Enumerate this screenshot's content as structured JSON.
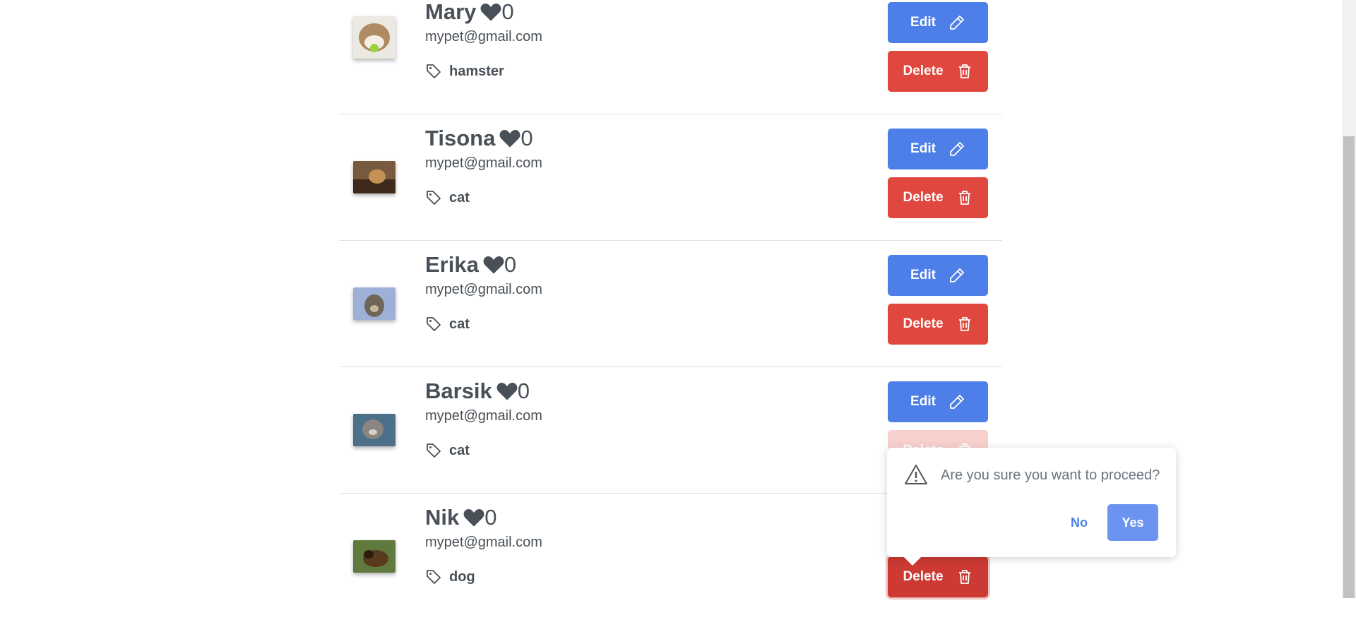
{
  "pets": [
    {
      "name": "Mary",
      "likes": "0",
      "email": "mypet@gmail.com",
      "tag": "hamster",
      "image": "hamster-photo"
    },
    {
      "name": "Tisona",
      "likes": "0",
      "email": "mypet@gmail.com",
      "tag": "cat",
      "image": "cat-photo"
    },
    {
      "name": "Erika",
      "likes": "0",
      "email": "mypet@gmail.com",
      "tag": "cat",
      "image": "cat-photo"
    },
    {
      "name": "Barsik",
      "likes": "0",
      "email": "mypet@gmail.com",
      "tag": "cat",
      "image": "cat-photo"
    },
    {
      "name": "Nik",
      "likes": "0",
      "email": "mypet@gmail.com",
      "tag": "dog",
      "image": "dog-photo"
    }
  ],
  "buttons": {
    "edit": "Edit",
    "delete": "Delete"
  },
  "confirm": {
    "message": "Are you sure you want to proceed?",
    "no": "No",
    "yes": "Yes"
  },
  "colors": {
    "edit": "#4e7fe9",
    "delete": "#e0473e",
    "yes": "#6b93ef"
  },
  "icons": {
    "like": "heart-icon",
    "tag": "tag-icon",
    "edit": "pencil-icon",
    "delete": "trash-icon",
    "warning": "warning-icon"
  }
}
